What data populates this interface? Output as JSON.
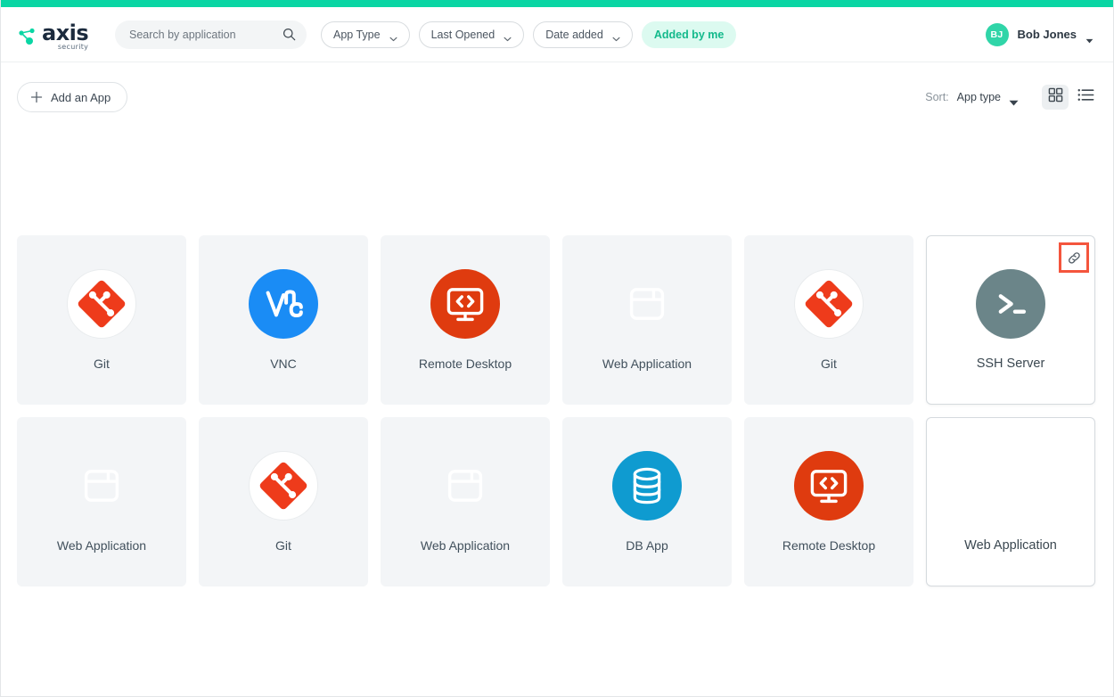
{
  "brand": {
    "name": "axis",
    "tagline": "security",
    "accent_color": "#0ad6a4",
    "logo_icon": "axis-node-graph-icon"
  },
  "header": {
    "search": {
      "placeholder": "Search by application",
      "value": "",
      "icon": "search-icon"
    },
    "filters": [
      {
        "label": "App Type",
        "icon": "chevron-down-icon",
        "active": false
      },
      {
        "label": "Last Opened",
        "icon": "chevron-down-icon",
        "active": false
      },
      {
        "label": "Date added",
        "icon": "chevron-down-icon",
        "active": false
      }
    ],
    "active_filter": {
      "label": "Added by me",
      "color": "#12b98b",
      "bg": "#dcfaf0"
    },
    "user": {
      "initials": "BJ",
      "name": "Bob Jones",
      "avatar_color": "#30d5a8",
      "icon": "chevron-down-icon"
    }
  },
  "toolbar": {
    "add_app_label": "Add an App",
    "add_app_icon": "plus-icon",
    "sort_label": "Sort:",
    "sort_value": "App type",
    "sort_icon": "chevron-down-solid-icon",
    "view_grid_icon": "grid-view-icon",
    "view_list_icon": "list-view-icon",
    "active_view": "grid"
  },
  "apps": [
    {
      "label": "Git",
      "icon": "git-icon",
      "color": "#ffffff",
      "selected": false,
      "link_badge": false
    },
    {
      "label": "VNC",
      "icon": "vnc-icon",
      "color": "#1a8cf5",
      "selected": false,
      "link_badge": false
    },
    {
      "label": "Remote Desktop",
      "icon": "remote-desktop-icon",
      "color": "#df3b0f",
      "selected": false,
      "link_badge": false
    },
    {
      "label": "Web Application",
      "icon": "web-application-icon",
      "color": "#c council",
      "selected": false,
      "link_badge": false
    },
    {
      "label": "Git",
      "icon": "git-icon",
      "color": "#ffffff",
      "selected": false,
      "link_badge": false
    },
    {
      "label": "SSH Server",
      "icon": "ssh-server-icon",
      "color": "#6b8589",
      "selected": true,
      "link_badge": true
    },
    {
      "label": "Web Application",
      "icon": "web-application-icon",
      "color": "#c council",
      "selected": false,
      "link_badge": false
    },
    {
      "label": "Git",
      "icon": "git-icon",
      "color": "#ffffff",
      "selected": false,
      "link_badge": false
    },
    {
      "label": "Web Application",
      "icon": "web-application-icon",
      "color": "#c council",
      "selected": false,
      "link_badge": false
    },
    {
      "label": "DB App",
      "icon": "db-app-icon",
      "color": "#0f9bd0",
      "selected": false,
      "link_badge": false
    },
    {
      "label": "Remote Desktop",
      "icon": "remote-desktop-icon",
      "color": "#df3b0f",
      "selected": false,
      "link_badge": false
    },
    {
      "label": "Web Application",
      "icon": "web-application-icon",
      "color": "#c council",
      "selected": true,
      "link_badge": false
    }
  ],
  "annotation": {
    "target": "link-icon",
    "color": "#f4553d"
  }
}
